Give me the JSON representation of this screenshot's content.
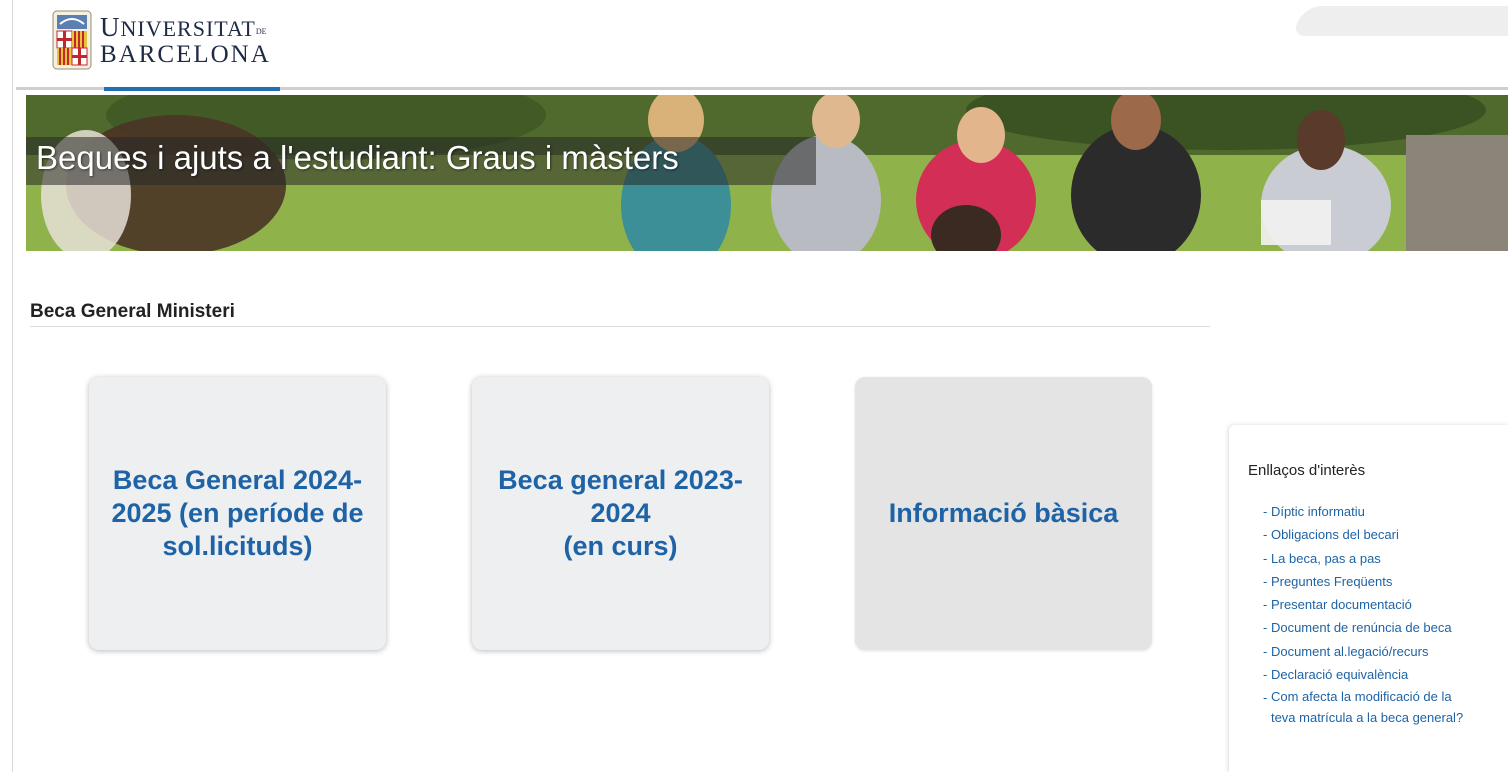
{
  "header": {
    "logo_line1_cap": "U",
    "logo_line1_rest": "NIVERSITAT",
    "logo_de": "DE",
    "logo_line2": "BARCELONA"
  },
  "banner": {
    "title": "Beques i ajuts a l'estudiant: Graus i màsters"
  },
  "section": {
    "title": "Beca General Ministeri"
  },
  "cards": [
    {
      "label": "Beca General 2024-\n2025 (en període de\nsol.licituds)"
    },
    {
      "label": "Beca general 2023-\n2024\n(en curs)"
    },
    {
      "label": "Informació bàsica"
    }
  ],
  "sidebar": {
    "title": "Enllaços d'interès",
    "links": [
      "Díptic informatiu",
      "Obligacions del becari",
      "La beca, pas a pas",
      "Preguntes Freqüents",
      "Presentar documentació",
      "Document de renúncia de beca",
      "Document al.legació/recurs",
      "Declaració equivalència",
      "Com afecta la modificació de la\nteva matrícula a la beca general?"
    ]
  },
  "colors": {
    "link_blue": "#1e63a6",
    "nav_active": "#1f6fb2",
    "card_bg": "#eeeff1"
  }
}
